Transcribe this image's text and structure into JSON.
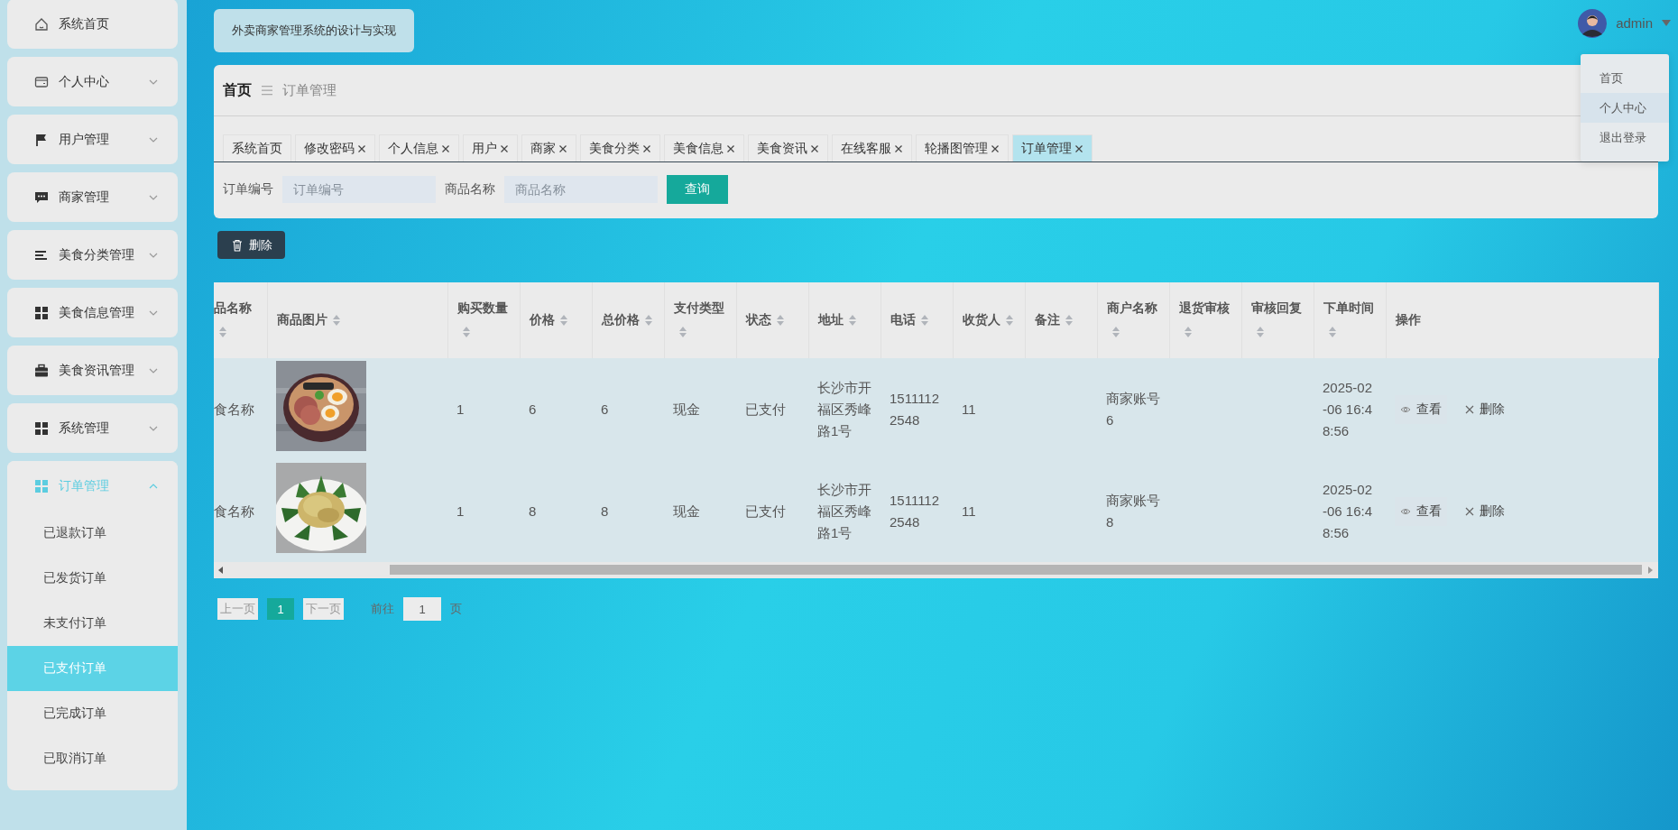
{
  "header": {
    "title": "外卖商家管理系统的设计与实现",
    "user": "admin",
    "user_menu": [
      {
        "label": "首页",
        "highlighted": false
      },
      {
        "label": "个人中心",
        "highlighted": true
      },
      {
        "label": "退出登录",
        "highlighted": false
      }
    ]
  },
  "sidebar": [
    {
      "label": "系统首页"
    },
    {
      "label": "个人中心",
      "expanded": false
    },
    {
      "label": "用户管理",
      "expanded": false
    },
    {
      "label": "商家管理",
      "expanded": false
    },
    {
      "label": "美食分类管理",
      "expanded": false
    },
    {
      "label": "美食信息管理",
      "expanded": false
    },
    {
      "label": "美食资讯管理",
      "expanded": false
    },
    {
      "label": "系统管理",
      "expanded": false
    },
    {
      "label": "订单管理",
      "expanded": true,
      "children": [
        {
          "label": "已退款订单",
          "selected": false
        },
        {
          "label": "已发货订单",
          "selected": false
        },
        {
          "label": "未支付订单",
          "selected": false
        },
        {
          "label": "已支付订单",
          "selected": true
        },
        {
          "label": "已完成订单",
          "selected": false
        },
        {
          "label": "已取消订单",
          "selected": false
        }
      ]
    }
  ],
  "breadcrumb": {
    "home": "首页",
    "current": "订单管理"
  },
  "tabs": [
    {
      "label": "系统首页",
      "closable": false,
      "selected": false
    },
    {
      "label": "修改密码",
      "closable": true,
      "selected": false
    },
    {
      "label": "个人信息",
      "closable": true,
      "selected": false
    },
    {
      "label": "用户",
      "closable": true,
      "selected": false
    },
    {
      "label": "商家",
      "closable": true,
      "selected": false
    },
    {
      "label": "美食分类",
      "closable": true,
      "selected": false
    },
    {
      "label": "美食信息",
      "closable": true,
      "selected": false
    },
    {
      "label": "美食资讯",
      "closable": true,
      "selected": false
    },
    {
      "label": "在线客服",
      "closable": true,
      "selected": false
    },
    {
      "label": "轮播图管理",
      "closable": true,
      "selected": false
    },
    {
      "label": "订单管理",
      "closable": true,
      "selected": true
    }
  ],
  "search": {
    "fields": [
      {
        "label": "订单编号",
        "placeholder": "订单编号"
      },
      {
        "label": "商品名称",
        "placeholder": "商品名称"
      }
    ],
    "button": "查询"
  },
  "toolbar": {
    "delete_button": "删除"
  },
  "table": {
    "columns": [
      {
        "label": "品名称",
        "kind": "text",
        "sortable": true
      },
      {
        "label": "商品图片",
        "sortable": true
      },
      {
        "label": "购买数量",
        "kind": "text",
        "sortable": true
      },
      {
        "label": "价格",
        "kind": "text",
        "sortable": true
      },
      {
        "label": "总价格",
        "kind": "text",
        "sortable": true
      },
      {
        "label": "支付类型",
        "kind": "text",
        "sortable": true
      },
      {
        "label": "状态",
        "kind": "text",
        "sortable": true
      },
      {
        "label": "地址",
        "kind": "text",
        "sortable": true
      },
      {
        "label": "电话",
        "kind": "text",
        "sortable": true
      },
      {
        "label": "收货人",
        "kind": "text",
        "sortable": true
      },
      {
        "label": "备注",
        "kind": "text",
        "sortable": true
      },
      {
        "label": "商户名称",
        "kind": "text",
        "sortable": true
      },
      {
        "label": "退货审核",
        "kind": "text",
        "sortable": true
      },
      {
        "label": "审核回复",
        "kind": "text",
        "sortable": true
      },
      {
        "label": "下单时间",
        "kind": "text",
        "sortable": true
      },
      {
        "label": "操作",
        "kind": "actions",
        "sortable": false
      }
    ],
    "rows": [
      {
        "cells": [
          "食名称",
          {
            "kind": "picture"
          },
          "1",
          "6",
          "6",
          "现金",
          "已支付",
          "长沙市开福区秀峰路1号",
          "15111122548",
          "11",
          "",
          "商家账号6",
          "",
          "",
          "2025-02-06 16:48:56",
          [
            {
              "label": "查看",
              "kind": "view"
            },
            {
              "label": "删除",
              "kind": "delete"
            }
          ]
        ]
      },
      {
        "cells": [
          "食名称",
          {
            "kind": "picture"
          },
          "1",
          "8",
          "8",
          "现金",
          "已支付",
          "长沙市开福区秀峰路1号",
          "15111122548",
          "11",
          "",
          "商家账号8",
          "",
          "",
          "2025-02-06 16:48:56",
          [
            {
              "label": "查看",
              "kind": "view"
            },
            {
              "label": "删除",
              "kind": "delete"
            }
          ]
        ]
      }
    ]
  },
  "pagination": {
    "prev": "上一页",
    "pages": [
      {
        "label": "1",
        "selected": true
      }
    ],
    "next": "下一页",
    "goto_label": "前往",
    "goto_value": "1",
    "goto_suffix": "页"
  }
}
